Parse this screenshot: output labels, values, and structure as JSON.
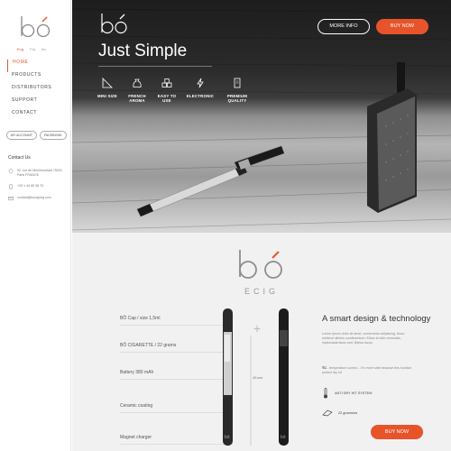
{
  "brand": {
    "logo_text": "bó",
    "accent": "#e8542a"
  },
  "sidebar": {
    "languages": [
      {
        "code": "Eng",
        "active": true
      },
      {
        "code": "Fra",
        "active": false
      },
      {
        "code": "Ita",
        "active": false
      }
    ],
    "nav": [
      {
        "label": "HOME",
        "active": true
      },
      {
        "label": "PRODUCTS",
        "active": false
      },
      {
        "label": "DISTRIBUTORS",
        "active": false
      },
      {
        "label": "SUPPORT",
        "active": false
      },
      {
        "label": "CONTACT",
        "active": false
      }
    ],
    "buttons": {
      "account": "MY ACCOUNT",
      "facebook": "FACEBOOK"
    },
    "contact": {
      "title": "Contact Us",
      "address": "92, rue de Ménilmontant 75020 Paris FRANCE",
      "phone": "+33 1 44 65 38 70",
      "email": "contact@bovaping.com"
    }
  },
  "hero": {
    "tagline": "Just Simple",
    "more_info": "MORE INFO",
    "buy_now": "BUY NOW",
    "features": [
      {
        "icon": "ruler-icon",
        "label": "MINI SIZE"
      },
      {
        "icon": "aroma-bag-icon",
        "label": "FRENCH AROMA"
      },
      {
        "icon": "blocks-icon",
        "label": "EASY TO USE"
      },
      {
        "icon": "lightning-icon",
        "label": "ELECTRONIC"
      },
      {
        "icon": "quality-badge-icon",
        "label": "PREMIUM QUALITY"
      }
    ]
  },
  "product": {
    "logo_text": "bó",
    "subtitle": "ECIG",
    "specs": [
      "BÔ Cap / size 1,5ml",
      "BÔ CIGARETTE / 22 grams",
      "Battery 380 mAh",
      "Ceramic coating",
      "Magnet charger"
    ],
    "plus_sign": "+",
    "dimension": "10 cm",
    "title": "A smart design & technology",
    "description": "Lorem ipsum dolor sit amet, consectetur adipiscing. Nunc eleifend ultrices condimentum. Etiam id nibh venenatis, malesuada lacus sed, finibus lacus.",
    "tc_label": "TC",
    "tc_text": " - temperature control... It's more safe because this function protect dry hit",
    "feature_1": "ANTI DRY HIT SYSTEM",
    "feature_2": "22 grammes",
    "buy_now": "BUY NOW"
  }
}
